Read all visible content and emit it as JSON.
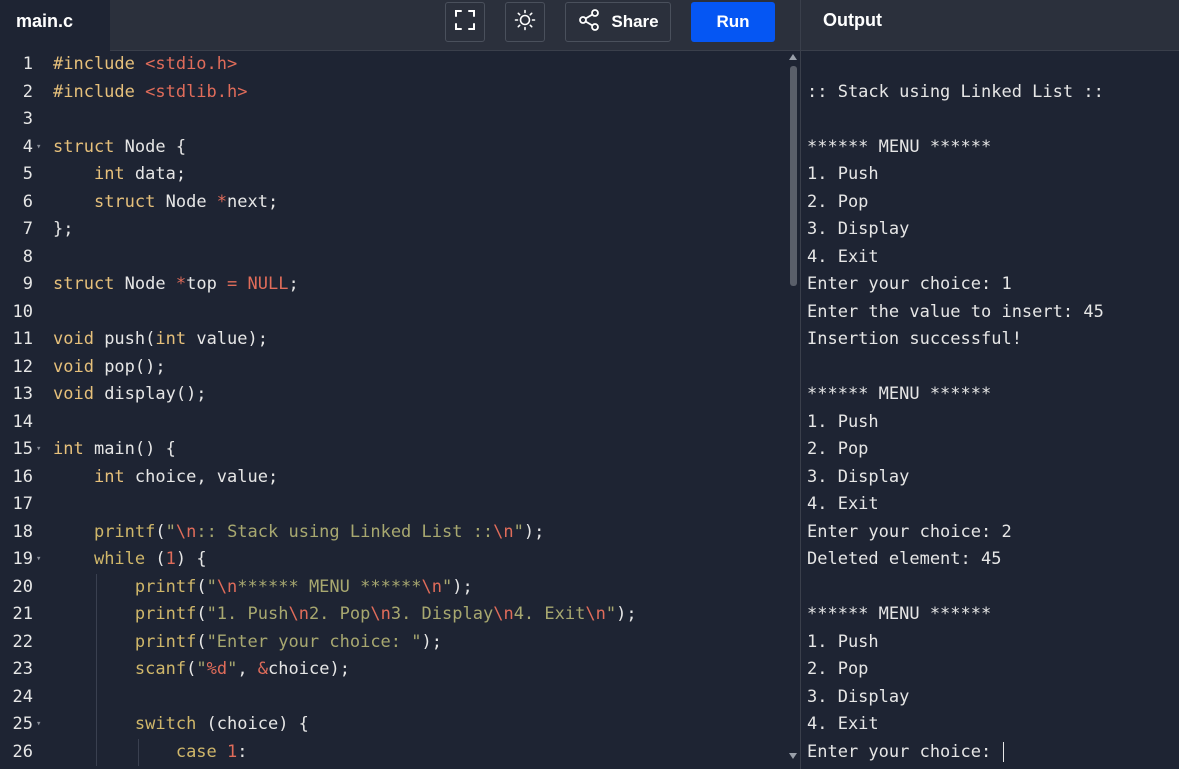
{
  "file_tab": {
    "label": "main.c"
  },
  "toolbar": {
    "fullscreen_icon": "fullscreen-icon",
    "theme_icon": "sun-icon",
    "share_label": "Share",
    "run_label": "Run"
  },
  "output_panel": {
    "title": "Output",
    "lines": [
      "",
      ":: Stack using Linked List ::",
      "",
      "****** MENU ******",
      "1. Push",
      "2. Pop",
      "3. Display",
      "4. Exit",
      "Enter your choice: 1",
      "Enter the value to insert: 45",
      "Insertion successful!",
      "",
      "****** MENU ******",
      "1. Push",
      "2. Pop",
      "3. Display",
      "4. Exit",
      "Enter your choice: 2",
      "Deleted element: 45",
      "",
      "****** MENU ******",
      "1. Push",
      "2. Pop",
      "3. Display",
      "4. Exit",
      "Enter your choice: "
    ]
  },
  "editor": {
    "line_numbers": [
      "1",
      "2",
      "3",
      "4",
      "5",
      "6",
      "7",
      "8",
      "9",
      "10",
      "11",
      "12",
      "13",
      "14",
      "15",
      "16",
      "17",
      "18",
      "19",
      "20",
      "21",
      "22",
      "23",
      "24",
      "25",
      "26"
    ],
    "fold_lines": [
      4,
      15,
      19,
      25
    ],
    "lines": [
      [
        {
          "t": "#include ",
          "c": "kw"
        },
        {
          "t": "<stdio.h>",
          "c": "inc"
        }
      ],
      [
        {
          "t": "#include ",
          "c": "kw"
        },
        {
          "t": "<stdlib.h>",
          "c": "inc"
        }
      ],
      [],
      [
        {
          "t": "struct ",
          "c": "kw"
        },
        {
          "t": "Node {",
          "c": ""
        }
      ],
      [
        {
          "t": "    ",
          "c": ""
        },
        {
          "t": "int ",
          "c": "kw"
        },
        {
          "t": "data;",
          "c": ""
        }
      ],
      [
        {
          "t": "    ",
          "c": ""
        },
        {
          "t": "struct ",
          "c": "kw"
        },
        {
          "t": "Node ",
          "c": ""
        },
        {
          "t": "*",
          "c": "op"
        },
        {
          "t": "next;",
          "c": ""
        }
      ],
      [
        {
          "t": "};",
          "c": ""
        }
      ],
      [],
      [
        {
          "t": "struct ",
          "c": "kw"
        },
        {
          "t": "Node ",
          "c": ""
        },
        {
          "t": "*",
          "c": "op"
        },
        {
          "t": "top ",
          "c": ""
        },
        {
          "t": "= ",
          "c": "op"
        },
        {
          "t": "NULL",
          "c": "num"
        },
        {
          "t": ";",
          "c": ""
        }
      ],
      [],
      [
        {
          "t": "void ",
          "c": "kw"
        },
        {
          "t": "push(",
          "c": ""
        },
        {
          "t": "int ",
          "c": "kw"
        },
        {
          "t": "value);",
          "c": ""
        }
      ],
      [
        {
          "t": "void ",
          "c": "kw"
        },
        {
          "t": "pop();",
          "c": ""
        }
      ],
      [
        {
          "t": "void ",
          "c": "kw"
        },
        {
          "t": "display();",
          "c": ""
        }
      ],
      [],
      [
        {
          "t": "int ",
          "c": "kw"
        },
        {
          "t": "main() {",
          "c": ""
        }
      ],
      [
        {
          "t": "    ",
          "c": ""
        },
        {
          "t": "int ",
          "c": "kw"
        },
        {
          "t": "choice, value;",
          "c": ""
        }
      ],
      [],
      [
        {
          "t": "    ",
          "c": ""
        },
        {
          "t": "printf",
          "c": "kw2"
        },
        {
          "t": "(",
          "c": ""
        },
        {
          "t": "\"",
          "c": "str"
        },
        {
          "t": "\\n",
          "c": "esc"
        },
        {
          "t": ":: Stack using Linked List ::",
          "c": "str"
        },
        {
          "t": "\\n",
          "c": "esc"
        },
        {
          "t": "\"",
          "c": "str"
        },
        {
          "t": ");",
          "c": ""
        }
      ],
      [
        {
          "t": "    ",
          "c": ""
        },
        {
          "t": "while ",
          "c": "kw2"
        },
        {
          "t": "(",
          "c": ""
        },
        {
          "t": "1",
          "c": "num"
        },
        {
          "t": ") {",
          "c": ""
        }
      ],
      [
        {
          "t": "        ",
          "c": ""
        },
        {
          "t": "printf",
          "c": "kw2"
        },
        {
          "t": "(",
          "c": ""
        },
        {
          "t": "\"",
          "c": "str"
        },
        {
          "t": "\\n",
          "c": "esc"
        },
        {
          "t": "****** MENU ******",
          "c": "str"
        },
        {
          "t": "\\n",
          "c": "esc"
        },
        {
          "t": "\"",
          "c": "str"
        },
        {
          "t": ");",
          "c": ""
        }
      ],
      [
        {
          "t": "        ",
          "c": ""
        },
        {
          "t": "printf",
          "c": "kw2"
        },
        {
          "t": "(",
          "c": ""
        },
        {
          "t": "\"1. Push",
          "c": "str"
        },
        {
          "t": "\\n",
          "c": "esc"
        },
        {
          "t": "2. Pop",
          "c": "str"
        },
        {
          "t": "\\n",
          "c": "esc"
        },
        {
          "t": "3. Display",
          "c": "str"
        },
        {
          "t": "\\n",
          "c": "esc"
        },
        {
          "t": "4. Exit",
          "c": "str"
        },
        {
          "t": "\\n",
          "c": "esc"
        },
        {
          "t": "\"",
          "c": "str"
        },
        {
          "t": ");",
          "c": ""
        }
      ],
      [
        {
          "t": "        ",
          "c": ""
        },
        {
          "t": "printf",
          "c": "kw2"
        },
        {
          "t": "(",
          "c": ""
        },
        {
          "t": "\"Enter your choice: \"",
          "c": "str"
        },
        {
          "t": ");",
          "c": ""
        }
      ],
      [
        {
          "t": "        ",
          "c": ""
        },
        {
          "t": "scanf",
          "c": "kw2"
        },
        {
          "t": "(",
          "c": ""
        },
        {
          "t": "\"",
          "c": "str"
        },
        {
          "t": "%d",
          "c": "esc"
        },
        {
          "t": "\"",
          "c": "str"
        },
        {
          "t": ", ",
          "c": ""
        },
        {
          "t": "&",
          "c": "op"
        },
        {
          "t": "choice);",
          "c": ""
        }
      ],
      [],
      [
        {
          "t": "        ",
          "c": ""
        },
        {
          "t": "switch ",
          "c": "kw2"
        },
        {
          "t": "(choice) {",
          "c": ""
        }
      ],
      [
        {
          "t": "            ",
          "c": ""
        },
        {
          "t": "case ",
          "c": "kw2"
        },
        {
          "t": "1",
          "c": "num"
        },
        {
          "t": ":",
          "c": ""
        }
      ]
    ]
  }
}
